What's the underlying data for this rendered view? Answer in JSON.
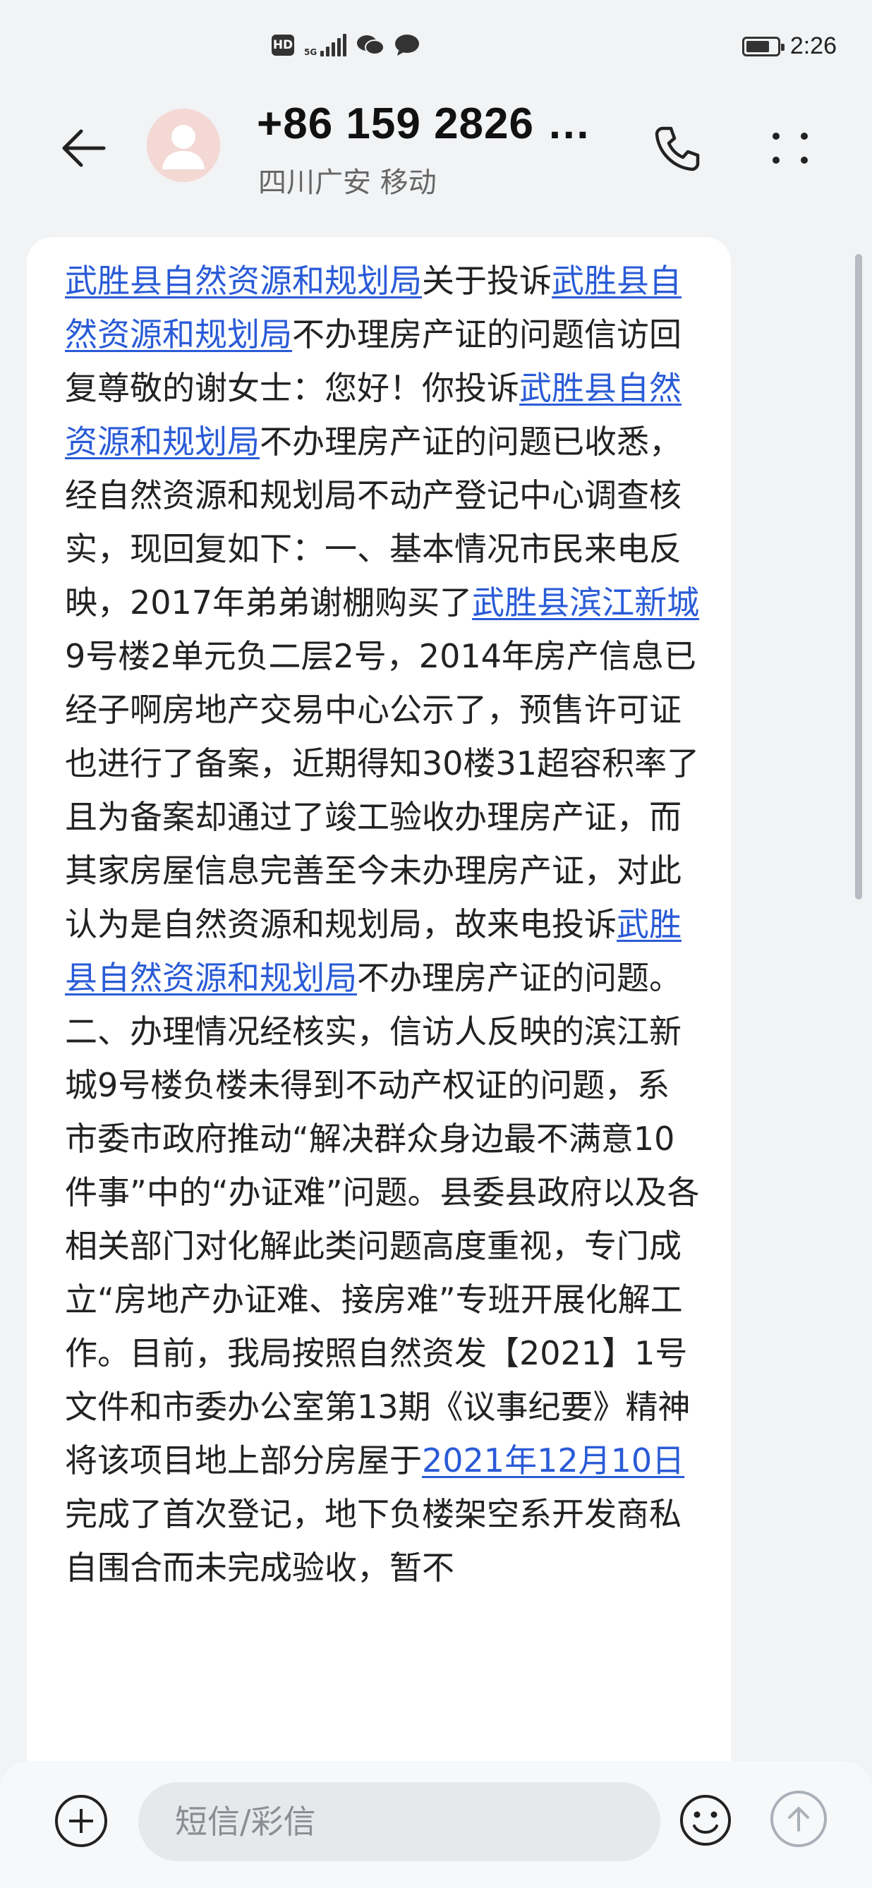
{
  "status_bar": {
    "hd_label": "HD",
    "network_label": "5G",
    "time": "2:26",
    "icons": [
      "hd-icon",
      "5g-signal-icon",
      "wechat-icon",
      "message-bubble-icon",
      "battery-charging-icon"
    ]
  },
  "header": {
    "title": "+86 159 2826 …",
    "subtitle": "四川广安 移动",
    "icons": [
      "back-arrow-icon",
      "avatar-icon",
      "phone-icon",
      "more-icon"
    ]
  },
  "message": {
    "segments": [
      {
        "text": "武胜县自然资源和规划局",
        "link": true
      },
      {
        "text": "关于投诉",
        "link": false
      },
      {
        "text": "武胜县自然资源和规划局",
        "link": true
      },
      {
        "text": "不办理房产证的问题信访回复尊敬的谢女士：您好！你投诉",
        "link": false
      },
      {
        "text": "武胜县自然资源和规划局",
        "link": true
      },
      {
        "text": "不办理房产证的问题已收悉，经自然资源和规划局不动产登记中心调查核实，现回复如下：一、基本情况市民来电反映，2017年弟弟谢棚购买了",
        "link": false
      },
      {
        "text": "武胜县滨江新城",
        "link": true
      },
      {
        "text": "9号楼2单元负二层2号，2014年房产信息已经子啊房地产交易中心公示了，预售许可证也进行了备案，近期得知30楼31超容积率了且为备案却通过了竣工验收办理房产证，而其家房屋信息完善至今未办理房产证，对此认为是自然资源和规划局，故来电投诉",
        "link": false
      },
      {
        "text": "武胜县自然资源和规划局",
        "link": true
      },
      {
        "text": "不办理房产证的问题。二、办理情况经核实，信访人反映的滨江新城9号楼负楼未得到不动产权证的问题，系市委市政府推动“解决群众身边最不满意10件事”中的“办证难”问题。县委县政府以及各相关部门对化解此类问题高度重视，专门成立“房地产办证难、接房难”专班开展化解工作。目前，我局按照自然资发【2021】1号文件和市委办公室第13期《议事纪要》精神将该项目地上部分房屋于",
        "link": false
      },
      {
        "text": "2021年12月10日",
        "link": true
      },
      {
        "text": "完成了首次登记，地下负楼架空系开发商私自围合而未完成验收，暂不",
        "link": false
      }
    ]
  },
  "input_bar": {
    "placeholder": "短信/彩信",
    "icons": [
      "add-icon",
      "emoji-icon",
      "send-icon"
    ]
  },
  "colors": {
    "background": "#f1f3f5",
    "bubble": "#ffffff",
    "link": "#2a5bd7"
  }
}
